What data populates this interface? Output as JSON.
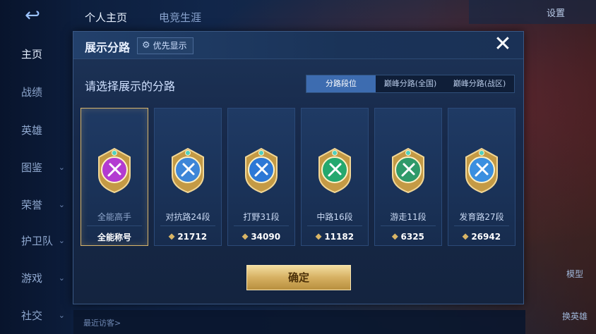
{
  "nav": {
    "items": [
      {
        "label": "主页"
      },
      {
        "label": "战绩"
      },
      {
        "label": "英雄"
      },
      {
        "label": "图鉴"
      },
      {
        "label": "荣誉"
      },
      {
        "label": "护卫队"
      },
      {
        "label": "游戏"
      },
      {
        "label": "社交"
      }
    ]
  },
  "top_tabs": [
    {
      "label": "个人主页"
    },
    {
      "label": "电竞生涯"
    }
  ],
  "top_right": {
    "settings_label": "设置"
  },
  "side_labels": {
    "model_label": "模型",
    "switch_hero_label": "换英雄"
  },
  "bottom": {
    "recent_visitors_label": "最近访客>"
  },
  "modal": {
    "title": "展示分路",
    "priority_label": "优先显示",
    "close_symbol": "✕",
    "subtitle": "请选择展示的分路",
    "tabs": [
      {
        "label": "分路段位",
        "active": true
      },
      {
        "label": "巅峰分路(全国)",
        "active": false
      },
      {
        "label": "巅峰分路(战区)",
        "active": false
      }
    ],
    "cards": [
      {
        "title": "全能高手",
        "score": "全能称号",
        "has_score_icon": false,
        "selected": true,
        "color": "#b33bd1",
        "icon": "all-round-icon"
      },
      {
        "title": "对抗路24段",
        "score": "21712",
        "has_score_icon": true,
        "selected": false,
        "color": "#3e86d8",
        "icon": "clash-lane-icon"
      },
      {
        "title": "打野31段",
        "score": "34090",
        "has_score_icon": true,
        "selected": false,
        "color": "#2d78d6",
        "icon": "jungle-icon"
      },
      {
        "title": "中路16段",
        "score": "11182",
        "has_score_icon": true,
        "selected": false,
        "color": "#25a86e",
        "icon": "mid-lane-icon"
      },
      {
        "title": "游走11段",
        "score": "6325",
        "has_score_icon": true,
        "selected": false,
        "color": "#2f9a6a",
        "icon": "roam-icon"
      },
      {
        "title": "发育路27段",
        "score": "26942",
        "has_score_icon": true,
        "selected": false,
        "color": "#3a8fe0",
        "icon": "farm-lane-icon"
      }
    ],
    "confirm_label": "确定"
  }
}
